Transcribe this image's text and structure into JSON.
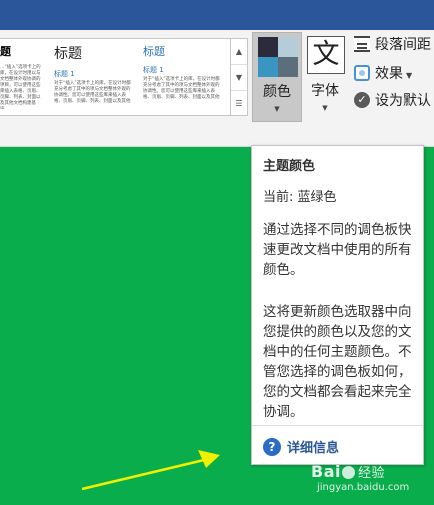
{
  "gallery": {
    "thumbs": [
      {
        "title": "题",
        "subtitle": "",
        "body": "…“插入”选项卡上的库，在设计时用以与文档整体外观协调的项目，可以使用这些库插入表格、页眉、页脚、列表、封面以及其他文档构建基块。"
      },
      {
        "title": "标题",
        "subtitle": "标题 1",
        "body": "对于“插入”选项卡上的库，在设计时都充分考虑了其中的项与文档整体外观的协调性。您可以使用这些库来插入表格、页眉、页脚、列表、封面以及其他"
      },
      {
        "title": "标题",
        "subtitle": "标题 1",
        "body": "对于“插入”选项卡上的库，在设计时都充分考虑了其中的项与文档整体外观的协调性。您可以使用这些库来插入表格、页眉、页脚、列表、封面以及其他"
      }
    ],
    "scroll_icons": [
      "scroll-up-icon",
      "scroll-down-icon",
      "gallery-more-icon"
    ]
  },
  "ribbon": {
    "colors_label": "颜色",
    "fonts_label": "字体",
    "fonts_glyph": "文",
    "paragraph_spacing_label": "段落间距",
    "effects_label": "效果",
    "set_default_label": "设为默认",
    "swatch_colors": [
      "#2b2b3b",
      "#b4cdd9",
      "#3a96c0",
      "#5a6e7c"
    ]
  },
  "tooltip": {
    "title": "主题颜色",
    "current": "当前: 蓝绿色",
    "paragraph1": "通过选择不同的调色板快速更改文档中使用的所有颜色。",
    "paragraph2": "这将更新颜色选取器中向您提供的颜色以及您的文档中的任何主题颜色。不管您选择的调色板如何，您的文档都会看起来完全协调。",
    "link_label": "详细信息",
    "link_icon": "help-question-icon"
  },
  "watermark": {
    "brand": "Bai",
    "brand_suffix": "经验",
    "url": "jingyan.baidu.com"
  },
  "colors": {
    "title_bar": "#2b579a",
    "document_bg": "#0aad4c",
    "arrow": "#f0f000"
  }
}
